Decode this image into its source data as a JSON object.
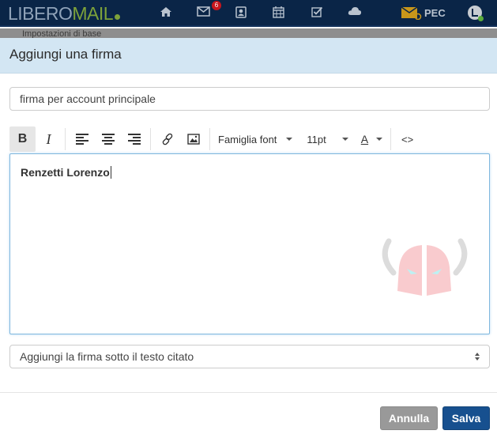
{
  "app": {
    "logo_part1": "LIBERO",
    "logo_part2": "MAIL",
    "brand_color": "#7da23a",
    "header_bg": "#0a2547"
  },
  "topnav": {
    "items": [
      {
        "name": "home",
        "icon": "home-icon"
      },
      {
        "name": "mail",
        "icon": "envelope-icon",
        "badge": "6"
      },
      {
        "name": "contacts",
        "icon": "contacts-icon"
      },
      {
        "name": "calendar",
        "icon": "calendar-icon"
      },
      {
        "name": "tasks",
        "icon": "checkbox-icon"
      },
      {
        "name": "cloud",
        "icon": "cloud-icon"
      }
    ],
    "pec_label": "PEC",
    "user_icon": "user-avatar-icon"
  },
  "background_page": {
    "breadcrumb": "Impostazioni di base"
  },
  "modal": {
    "title": "Aggiungi una firma",
    "signature_name_value": "firma per account principale",
    "toolbar": {
      "bold": "B",
      "italic": "I",
      "align_left": "align-left",
      "align_center": "align-center",
      "align_right": "align-right",
      "link": "link",
      "image": "image",
      "font_family_label": "Famiglia font",
      "font_size_label": "11pt",
      "font_color_label": "A",
      "code_view": "<>"
    },
    "editor_content": "Renzetti Lorenzo",
    "position_select_value": "Aggiungi la firma sotto il testo citato",
    "cancel_label": "Annulla",
    "save_label": "Salva"
  }
}
